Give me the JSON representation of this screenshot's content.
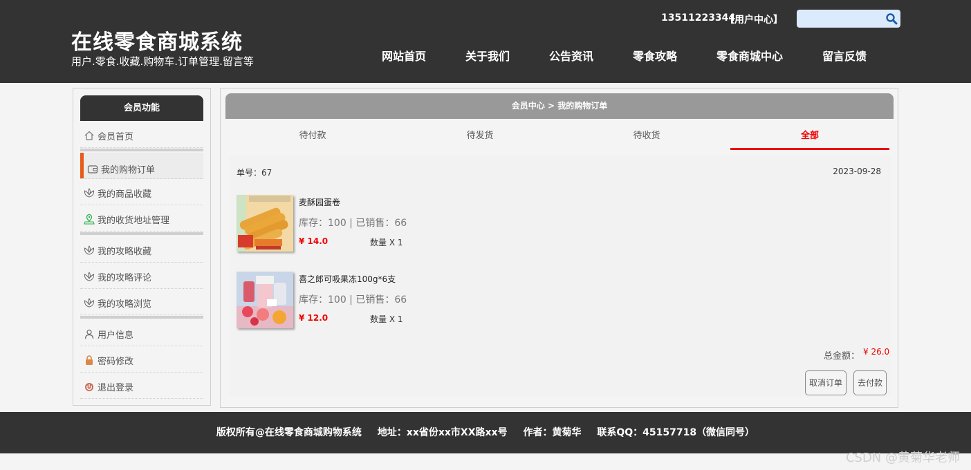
{
  "header": {
    "site_title": "在线零食商城系统",
    "site_subtitle": "用户.零食.收藏.购物车.订单管理.留言等",
    "user_phone": "13511223344",
    "user_center": "【用户中心】",
    "search_placeholder": "",
    "nav": [
      "网站首页",
      "关于我们",
      "公告资讯",
      "零食攻略",
      "零食商城中心",
      "留言反馈"
    ]
  },
  "sidebar": {
    "title": "会员功能",
    "items": [
      {
        "label": "会员首页",
        "icon": "home-icon"
      },
      {
        "label": "我的购物订单",
        "icon": "wallet-icon"
      },
      {
        "label": "我的商品收藏",
        "icon": "lotus-icon"
      },
      {
        "label": "我的收货地址管理",
        "icon": "location-icon"
      },
      {
        "label": "我的攻略收藏",
        "icon": "lotus-icon"
      },
      {
        "label": "我的攻略评论",
        "icon": "lotus-icon"
      },
      {
        "label": "我的攻略浏览",
        "icon": "lotus-icon"
      },
      {
        "label": "用户信息",
        "icon": "user-icon"
      },
      {
        "label": "密码修改",
        "icon": "lock-icon"
      },
      {
        "label": "退出登录",
        "icon": "power-icon"
      }
    ]
  },
  "main": {
    "breadcrumb": "会员中心 > 我的购物订单",
    "tabs": [
      "待付款",
      "待发货",
      "待收货",
      "全部"
    ],
    "active_tab": "全部",
    "order": {
      "number_label": "单号：67",
      "date": "2023-09-28",
      "items": [
        {
          "name": "麦酥园蛋卷",
          "stock": "库存：100 | 已销售：66",
          "price": "¥ 14.0",
          "qty": "数量 X 1"
        },
        {
          "name": "喜之郎可吸果冻100g*6支",
          "stock": "库存：100 | 已销售：66",
          "price": "¥ 12.0",
          "qty": "数量 X 1"
        }
      ],
      "total_label": "总金额：",
      "total_value": "¥ 26.0",
      "cancel_button": "取消订单",
      "pay_button": "去付款"
    }
  },
  "footer": {
    "copyright": "版权所有@在线零食商城购物系统",
    "address": "地址：xx省份xx市XX路xx号",
    "author": "作者：黄菊华",
    "contact": "联系QQ：45157718（微信同号）"
  },
  "watermark": "CSDN @黄菊华老师",
  "colors": {
    "header_bg": "#333333",
    "accent_red": "#ee0000",
    "active_bar": "#e85a1a",
    "breadcrumb_bg": "#999999"
  }
}
